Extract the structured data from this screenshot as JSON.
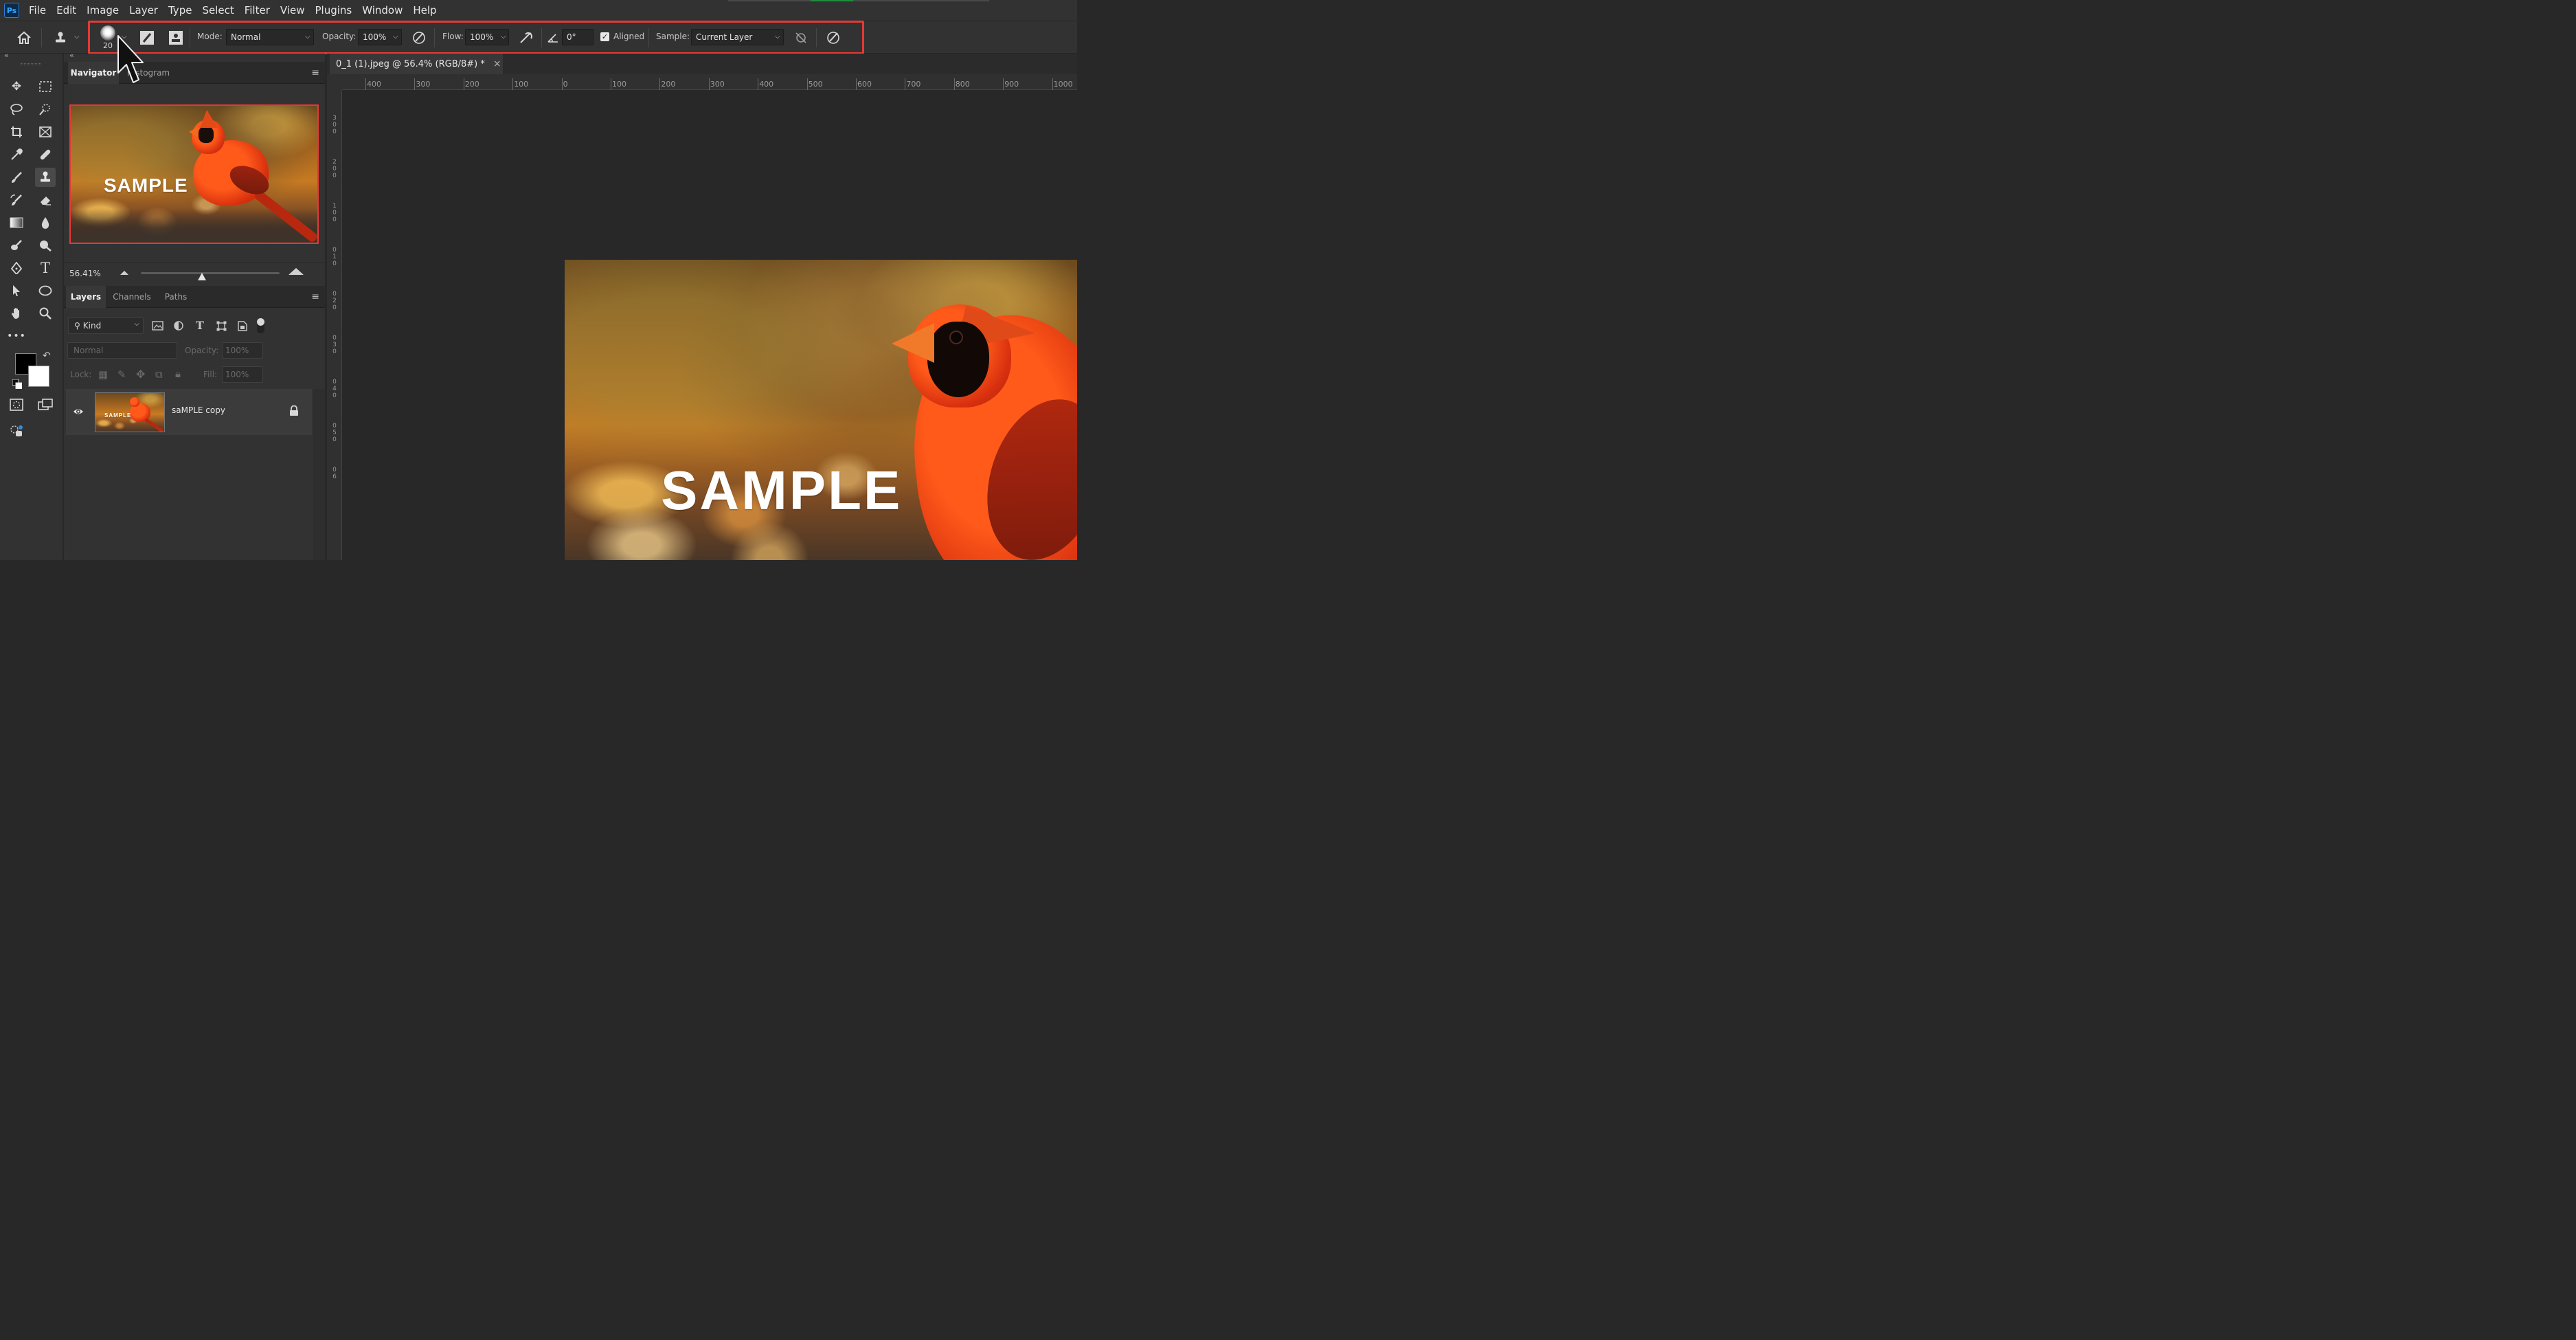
{
  "app": {
    "logo": "Ps"
  },
  "menu": [
    "File",
    "Edit",
    "Image",
    "Layer",
    "Type",
    "Select",
    "Filter",
    "View",
    "Plugins",
    "Window",
    "Help"
  ],
  "options_bar": {
    "brush_size": "20",
    "mode_label": "Mode:",
    "mode_value": "Normal",
    "opacity_label": "Opacity:",
    "opacity_value": "100%",
    "flow_label": "Flow:",
    "flow_value": "100%",
    "angle_value": "0°",
    "aligned_label": "Aligned",
    "aligned_checked": true,
    "sample_label": "Sample:",
    "sample_value": "Current Layer",
    "highlight_color": "#e53935"
  },
  "toolbar": {
    "tools": [
      "move-icon",
      "marquee-icon",
      "lasso-icon",
      "quick-select-icon",
      "crop-icon",
      "frame-icon",
      "eyedropper-icon",
      "healing-icon",
      "brush-icon",
      "clone-stamp-icon",
      "history-brush-icon",
      "eraser-icon",
      "gradient-icon",
      "blur-icon",
      "dodge-icon",
      "sponge-icon",
      "pen-icon",
      "type-icon",
      "path-select-icon",
      "ellipse-icon",
      "hand-icon",
      "zoom-icon",
      "more-icon"
    ],
    "active_tool": "clone-stamp-icon",
    "foreground_color": "#000000",
    "background_color": "#ffffff"
  },
  "navigator": {
    "tabs": [
      "Navigator",
      "Histogram"
    ],
    "active_tab": "Navigator",
    "zoom": "56.41%",
    "zoom_slider": 0.44
  },
  "layers": {
    "tabs": [
      "Layers",
      "Channels",
      "Paths"
    ],
    "active_tab": "Layers",
    "filter_kind": "Kind",
    "blend_mode": "Normal",
    "opacity_label": "Opacity:",
    "opacity_value": "100%",
    "lock_label": "Lock:",
    "fill_label": "Fill:",
    "fill_value": "100%",
    "items": [
      {
        "name": "saMPLE copy",
        "visible": true,
        "locked": true
      }
    ]
  },
  "document": {
    "tab_title": "0_1 (1).jpeg @ 56.4% (RGB/8#) *",
    "ruler_h": [
      "400",
      "300",
      "200",
      "100",
      "0",
      "100",
      "200",
      "300",
      "400",
      "500",
      "600",
      "700",
      "800",
      "900",
      "1000"
    ],
    "ruler_v": [
      "3",
      "0",
      "0",
      "2",
      "0",
      "0",
      "1",
      "0",
      "0",
      "0",
      "1",
      "0",
      "0",
      "2",
      "0",
      "0",
      "3",
      "0",
      "0",
      "4",
      "0",
      "0",
      "5",
      "0",
      "0",
      "6"
    ],
    "watermark": "SAMPLE"
  }
}
